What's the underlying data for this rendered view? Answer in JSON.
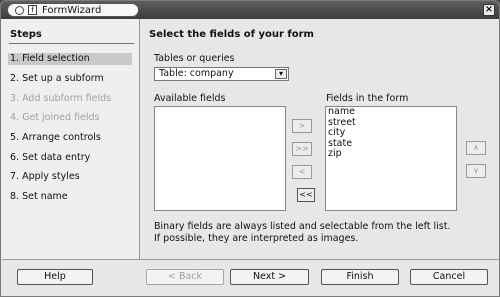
{
  "window": {
    "title": "FormWizard",
    "close_icon": "x-icon"
  },
  "steps": {
    "header": "Steps",
    "items": [
      {
        "label": "1. Field selection",
        "state": "active"
      },
      {
        "label": "2. Set up a subform",
        "state": "normal"
      },
      {
        "label": "3. Add subform fields",
        "state": "disabled"
      },
      {
        "label": "4. Get joined fields",
        "state": "disabled"
      },
      {
        "label": "5. Arrange controls",
        "state": "normal"
      },
      {
        "label": "6. Set data entry",
        "state": "normal"
      },
      {
        "label": "7. Apply styles",
        "state": "normal"
      },
      {
        "label": "8. Set name",
        "state": "normal"
      }
    ]
  },
  "main": {
    "title": "Select the fields of your form",
    "tables_label": "Tables or queries",
    "table_value": "Table: company",
    "available_label": "Available fields",
    "fields_in_form_label": "Fields in the form",
    "available_fields": [],
    "form_fields": [
      "name",
      "street",
      "city",
      "state",
      "zip"
    ],
    "move_buttons": {
      "add_one": ">",
      "add_all": ">>",
      "remove_one": "<",
      "remove_all": "<<"
    },
    "order_buttons": {
      "up": "^",
      "down": "v"
    },
    "info_lines": [
      "Binary fields are always listed and selectable from the left list.",
      "If possible, they are interpreted as images."
    ]
  },
  "footer": {
    "help": "Help",
    "back": "< Back",
    "next": "Next >",
    "finish": "Finish",
    "cancel": "Cancel"
  }
}
